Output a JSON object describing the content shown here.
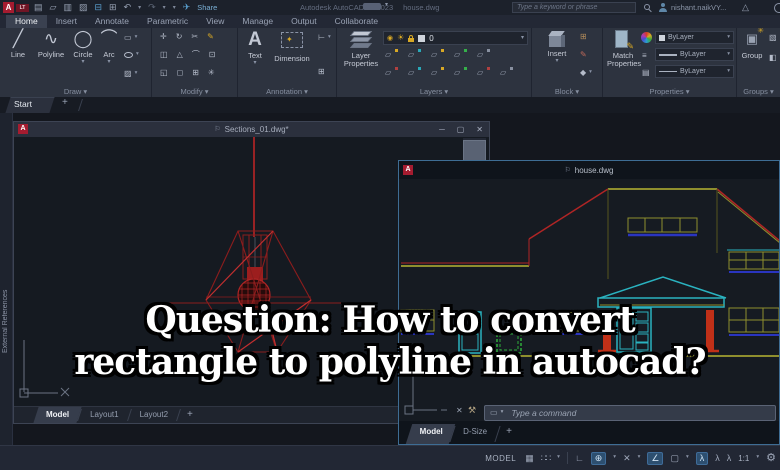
{
  "titlebar": {
    "app_title": "Autodesk AutoCAD LT 2023",
    "doc_title": "house.dwg",
    "share_label": "Share",
    "search_placeholder": "Type a keyword or phrase",
    "user_name": "nishant.naikVY...",
    "logo_badge": "A",
    "logo_lt": "LT"
  },
  "ribbon_tabs": [
    {
      "label": "Home"
    },
    {
      "label": "Insert"
    },
    {
      "label": "Annotate"
    },
    {
      "label": "Parametric"
    },
    {
      "label": "View"
    },
    {
      "label": "Manage"
    },
    {
      "label": "Output"
    },
    {
      "label": "Collaborate"
    }
  ],
  "panels": {
    "draw": {
      "label": "Draw",
      "line": "Line",
      "polyline": "Polyline",
      "circle": "Circle",
      "arc": "Arc"
    },
    "modify": {
      "label": "Modify"
    },
    "annotation": {
      "label": "Annotation",
      "text": "Text",
      "dimension": "Dimension"
    },
    "layers": {
      "label": "Layers",
      "layer_properties_1": "Layer",
      "layer_properties_2": "Properties",
      "current_layer": "0"
    },
    "block": {
      "label": "Block",
      "insert": "Insert"
    },
    "properties": {
      "label": "Properties",
      "match_1": "Match",
      "match_2": "Properties",
      "color_value": "ByLayer",
      "lineweight_value": "ByLayer",
      "linetype_value": "ByLayer"
    },
    "groups": {
      "label": "Groups",
      "group": "Group"
    }
  },
  "file_tabs": {
    "start": "Start"
  },
  "palette": {
    "external_references": "External References"
  },
  "sections_window": {
    "title": "Sections_01.dwg*",
    "tab_model": "Model",
    "tab_layout1": "Layout1",
    "tab_layout2": "Layout2"
  },
  "house_window": {
    "title": "house.dwg",
    "tab_model": "Model",
    "tab_dsize": "D-Size",
    "command_placeholder": "Type a command"
  },
  "status_bar": {
    "model_label": "MODEL",
    "scale": "1:1"
  },
  "overlay": {
    "line1": "Question: How to convert",
    "line2": "rectangle to polyline in autocad?"
  },
  "colors": {
    "drawing_red": "#b02525",
    "house_olive": "#8f8f2e",
    "house_cyan": "#2ab3c0",
    "house_blue": "#2a35c0",
    "house_green": "#2fae3a",
    "column_red": "#c03018",
    "accent_yellow": "#d8a825",
    "active_window_border": "#3e6d94",
    "badge_red": "#a51c30"
  },
  "icons": {
    "chevron_down": "▾",
    "new_file": "▤",
    "open_file": "▱",
    "save": "▥",
    "save_as": "▨",
    "plot": "⊟",
    "print": "⊞",
    "undo": "↶",
    "redo": "↷",
    "share_plane": "✈",
    "autodesk_logo": "△",
    "pin": "⚐",
    "minimize": "─",
    "maximize": "▢",
    "close": "✕",
    "line": "╱",
    "polyline": "∿",
    "circle": "◯",
    "arc": "⌒",
    "rectangle": "▭",
    "hatch": "▨",
    "move": "✛",
    "rotate": "↻",
    "trim": "✂",
    "erase": "✎",
    "copy": "◫",
    "mirror": "△",
    "fillet": "⌒",
    "offset": "⊡",
    "stretch": "◱",
    "scale": "◻",
    "array": "⊞",
    "explode": "✳",
    "text_tool": "A",
    "sparkle": "✦",
    "leader": "⊢",
    "table": "⊞",
    "bulb": "◉",
    "sun": "☀",
    "layer_mini": "▱",
    "block_small_1": "⊞",
    "block_small_2": "✎",
    "block_small_3": "◆",
    "lineweight": "≡",
    "transparency": "▤",
    "group_star": "✳",
    "group_box": "▣",
    "groups_mini_1": "▧",
    "groups_mini_2": "◧",
    "grid": "▦",
    "snap": "∷∷",
    "ortho": "∟",
    "polar": "⊕",
    "isoplane": "✕",
    "otrack": "∠",
    "osnap": "▢",
    "annot_figure": "λ",
    "gear": "⚙",
    "wrench": "⚒",
    "cmd_icon": "▭",
    "plus": "+"
  }
}
